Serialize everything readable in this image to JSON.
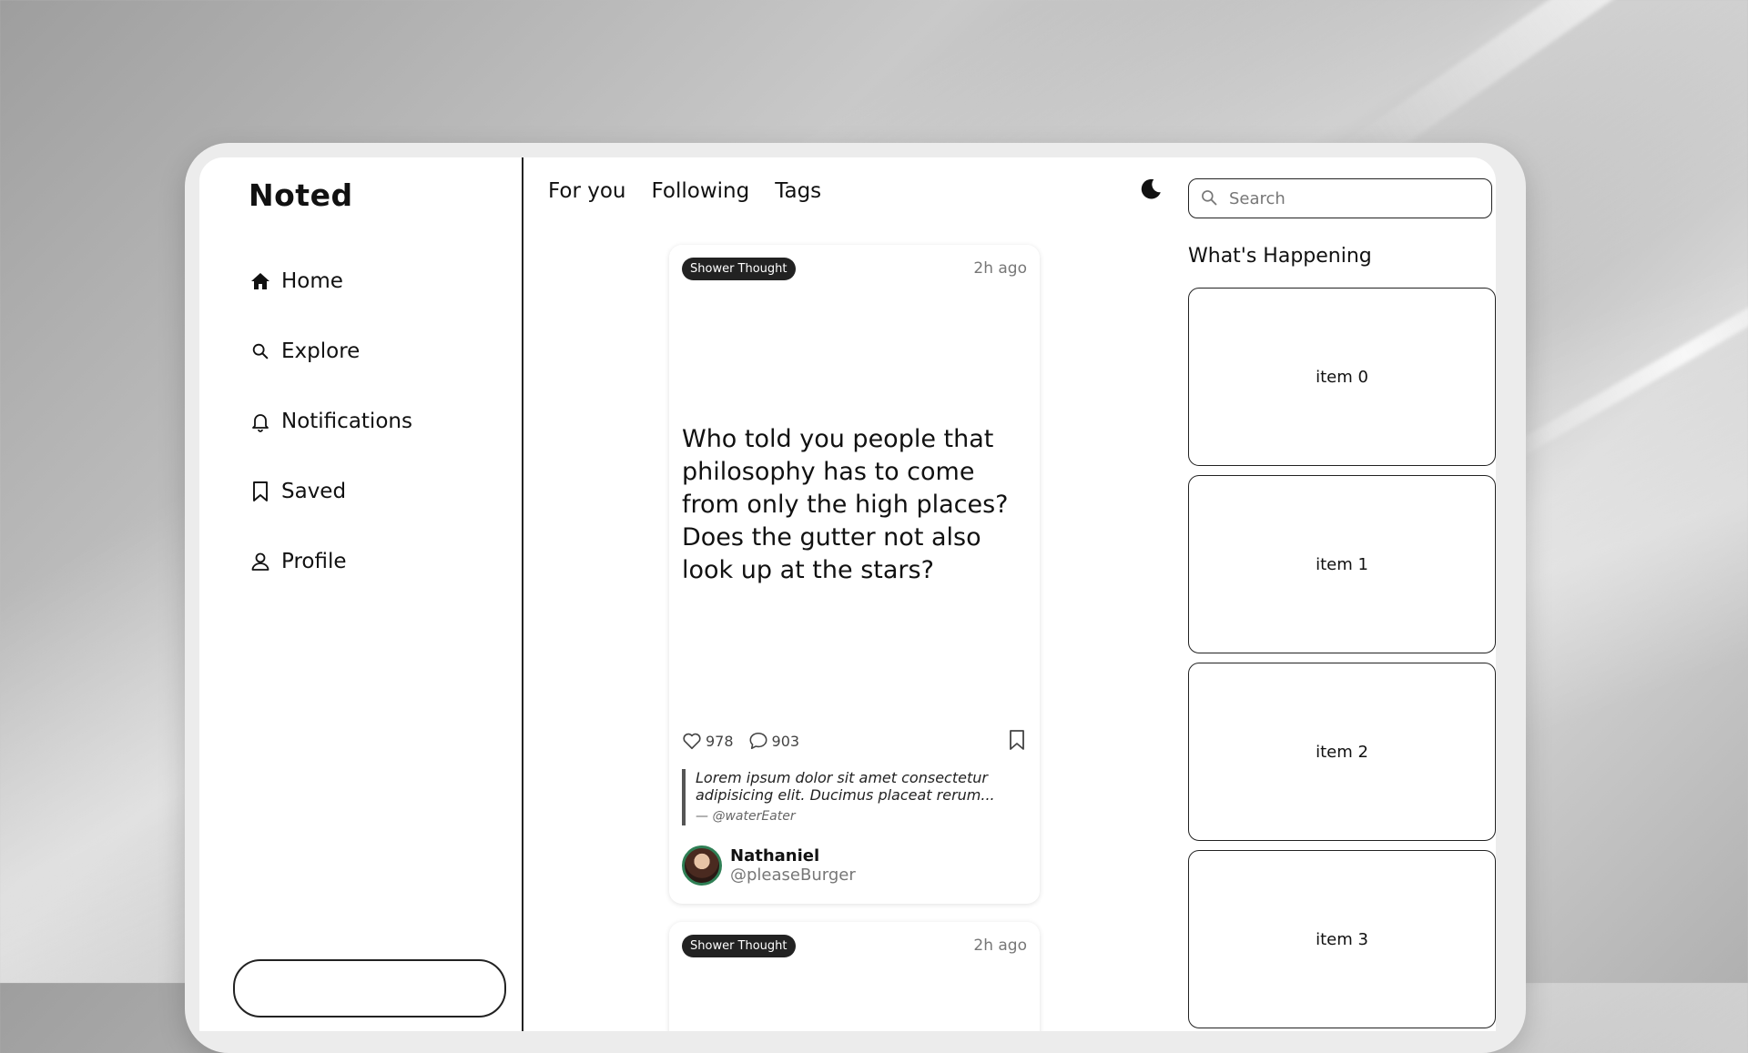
{
  "app": {
    "logo": "Noted"
  },
  "sidebar": {
    "items": [
      {
        "label": "Home",
        "icon": "home-icon"
      },
      {
        "label": "Explore",
        "icon": "search-icon"
      },
      {
        "label": "Notifications",
        "icon": "bell-icon"
      },
      {
        "label": "Saved",
        "icon": "bookmark-icon"
      },
      {
        "label": "Profile",
        "icon": "user-icon"
      }
    ]
  },
  "tabs": [
    "For you",
    "Following",
    "Tags"
  ],
  "search": {
    "placeholder": "Search"
  },
  "whats_happening": {
    "title": "What's Happening",
    "items": [
      "item 0",
      "item 1",
      "item 2",
      "item 3"
    ]
  },
  "posts": [
    {
      "tag": "Shower Thought",
      "time": "2h ago",
      "body": "Who told you people that philosophy has to come from only the high places? Does the gutter not also look up at the stars?",
      "likes": "978",
      "comments": "903",
      "quote": {
        "text": "Lorem ipsum dolor sit amet consectetur adipisicing elit. Ducimus placeat rerum...",
        "by": "— @waterEater"
      },
      "author": {
        "name": "Nathaniel",
        "handle": "@pleaseBurger"
      }
    },
    {
      "tag": "Shower Thought",
      "time": "2h ago"
    }
  ]
}
